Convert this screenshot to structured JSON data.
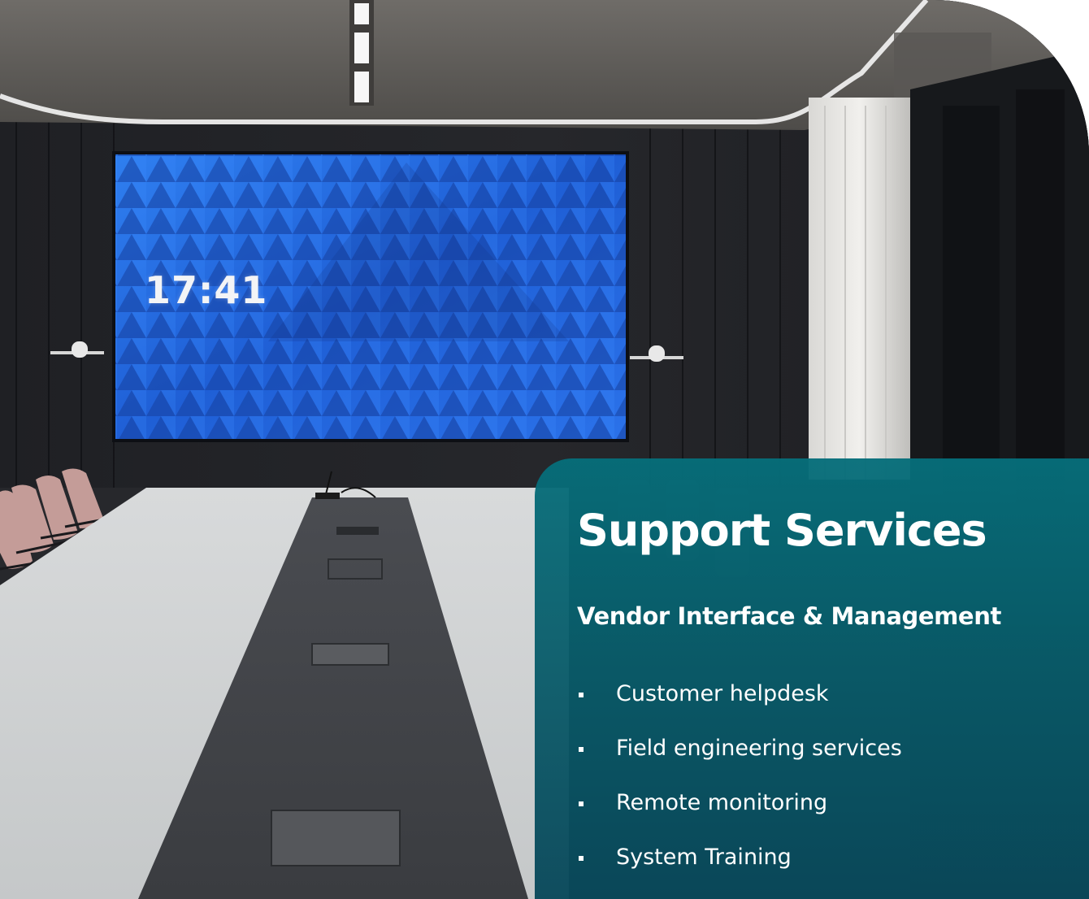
{
  "photo": {
    "description_icon": "conference-room-photo",
    "screen_clock": "17:41"
  },
  "panel": {
    "title": "Support Services",
    "subtitle": "Vendor Interface & Management",
    "items": [
      {
        "label": "Customer helpdesk"
      },
      {
        "label": "Field engineering services"
      },
      {
        "label": "Remote monitoring"
      },
      {
        "label": "System Training"
      }
    ],
    "colors": {
      "panel_top": "#066E7A",
      "panel_bottom": "#09485A",
      "text": "#FFFFFF"
    }
  }
}
